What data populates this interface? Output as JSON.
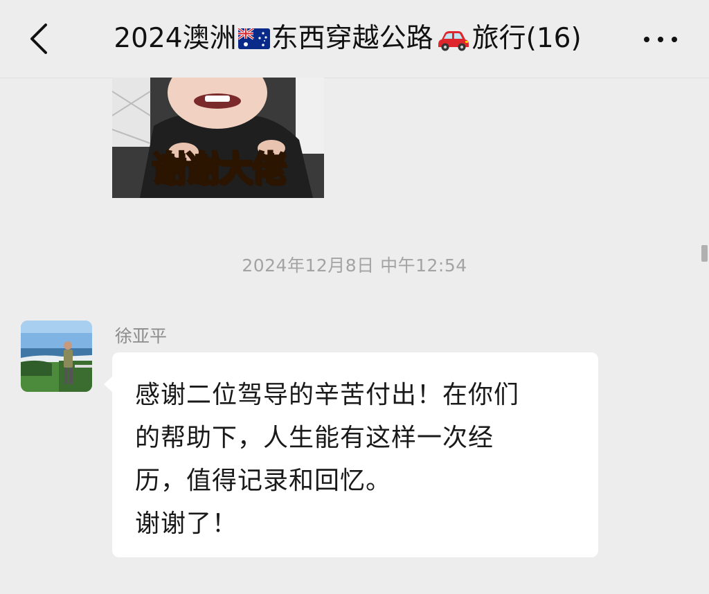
{
  "header": {
    "title_year": "2024澳洲",
    "title_route": "东西穿越公路",
    "title_trip": "旅行(16)",
    "flag_icon": "australia-flag-icon",
    "car_icon": "red-car-icon"
  },
  "messages": {
    "sticker": {
      "caption": "谢谢大佬"
    },
    "timestamp": "2024年12月8日 中午12:54",
    "text_message": {
      "sender": "徐亚平",
      "text": "感谢二位驾导的辛苦付出！在你们\n的帮助下，人生能有这样一次经\n历，值得记录和回忆。\n谢谢了！"
    }
  },
  "colors": {
    "background": "#ededed",
    "bubble": "#ffffff",
    "timestamp": "#a3a3a3",
    "sender_name": "#8c8c8c"
  }
}
